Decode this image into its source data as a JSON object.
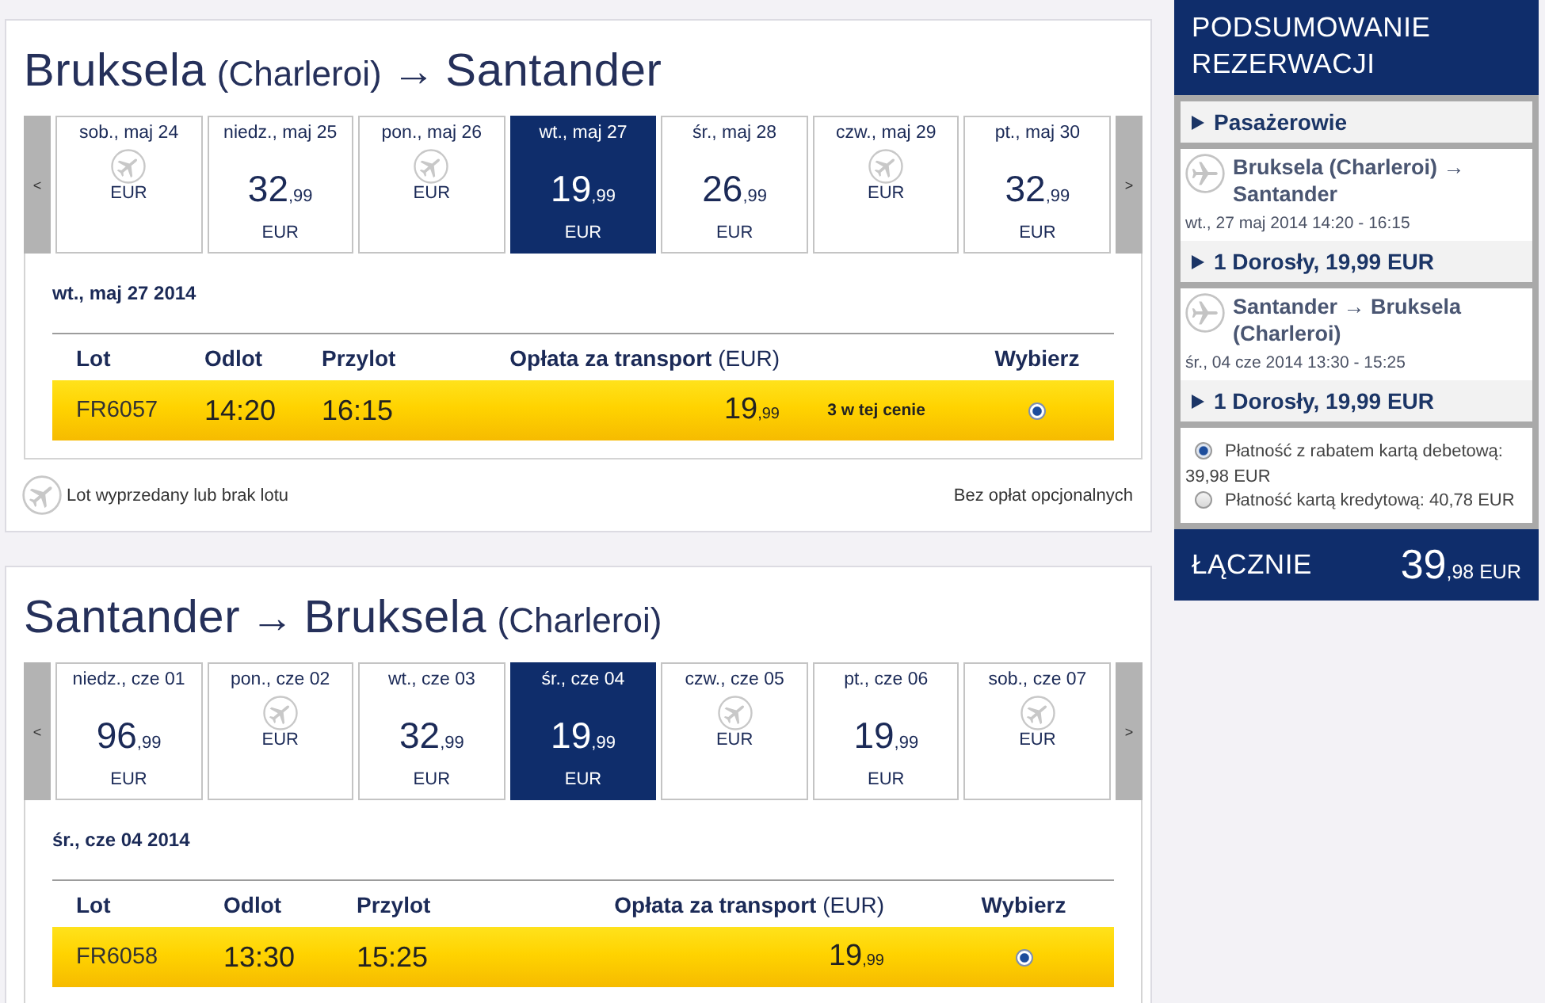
{
  "journeys": [
    {
      "title_parts": [
        {
          "kind": "city",
          "text": "Bruksela"
        },
        {
          "kind": "airport",
          "text": "(Charleroi)"
        },
        {
          "kind": "arrow",
          "text": "→"
        },
        {
          "kind": "city",
          "text": "Santander"
        }
      ],
      "prev": "<",
      "next": ">",
      "dates": [
        {
          "label": "sob., maj 24",
          "kind": "sold_out",
          "currency": "EUR",
          "selected": false
        },
        {
          "label": "niedz., maj 25",
          "kind": "fare",
          "price": "32",
          "cents": ",99",
          "currency": "EUR",
          "selected": false
        },
        {
          "label": "pon., maj 26",
          "kind": "sold_out",
          "currency": "EUR",
          "selected": false
        },
        {
          "label": "wt., maj 27",
          "kind": "fare",
          "price": "19",
          "cents": ",99",
          "currency": "EUR",
          "selected": true
        },
        {
          "label": "śr., maj 28",
          "kind": "fare",
          "price": "26",
          "cents": ",99",
          "currency": "EUR",
          "selected": false
        },
        {
          "label": "czw., maj 29",
          "kind": "sold_out",
          "currency": "EUR",
          "selected": false
        },
        {
          "label": "pt., maj 30",
          "kind": "fare",
          "price": "32",
          "cents": ",99",
          "currency": "EUR",
          "selected": false
        }
      ],
      "day_heading": "wt., maj 27 2014",
      "columns": [
        {
          "label": "Lot"
        },
        {
          "label": "Odlot"
        },
        {
          "label": "Przylot"
        },
        {
          "label": "Opłata za transport",
          "unit": "(EUR)"
        },
        {
          "label": "Wybierz"
        }
      ],
      "rows": [
        {
          "flight": "FR6057",
          "departure": "14:20",
          "arrival": "16:15",
          "price": "19",
          "cents": ",99",
          "note": "3 w tej cenie",
          "selected": true
        }
      ],
      "legend": {
        "text": "Lot wyprzedany lub brak lotu",
        "note": "Bez opłat opcjonalnych"
      }
    },
    {
      "title_parts": [
        {
          "kind": "city",
          "text": "Santander"
        },
        {
          "kind": "arrow",
          "text": "→"
        },
        {
          "kind": "city",
          "text": "Bruksela"
        },
        {
          "kind": "airport",
          "text": "(Charleroi)"
        }
      ],
      "prev": "<",
      "next": ">",
      "dates": [
        {
          "label": "niedz., cze 01",
          "kind": "fare",
          "price": "96",
          "cents": ",99",
          "currency": "EUR",
          "selected": false
        },
        {
          "label": "pon., cze 02",
          "kind": "sold_out",
          "currency": "EUR",
          "selected": false
        },
        {
          "label": "wt., cze 03",
          "kind": "fare",
          "price": "32",
          "cents": ",99",
          "currency": "EUR",
          "selected": false
        },
        {
          "label": "śr., cze 04",
          "kind": "fare",
          "price": "19",
          "cents": ",99",
          "currency": "EUR",
          "selected": true
        },
        {
          "label": "czw., cze 05",
          "kind": "sold_out",
          "currency": "EUR",
          "selected": false
        },
        {
          "label": "pt., cze 06",
          "kind": "fare",
          "price": "19",
          "cents": ",99",
          "currency": "EUR",
          "selected": false
        },
        {
          "label": "sob., cze 07",
          "kind": "sold_out",
          "currency": "EUR",
          "selected": false
        }
      ],
      "day_heading": "śr., cze 04 2014",
      "columns": [
        {
          "label": "Lot"
        },
        {
          "label": "Odlot"
        },
        {
          "label": "Przylot"
        },
        {
          "label": "Opłata za transport",
          "unit": "(EUR)"
        },
        {
          "label": "Wybierz"
        }
      ],
      "rows": [
        {
          "flight": "FR6058",
          "departure": "13:30",
          "arrival": "15:25",
          "price": "19",
          "cents": ",99",
          "selected": true
        }
      ]
    }
  ],
  "summary": {
    "title": "PODSUMOWANIE REZERWACJI",
    "blocks": [
      {
        "items": [
          {
            "kind": "toggle",
            "label": "Pasażerowie",
            "expanded": false
          }
        ]
      },
      {
        "items": [
          {
            "kind": "flight",
            "route": "Bruksela (Charleroi) → Santander",
            "time": "wt., 27 maj 2014 14:20 - 16:15"
          },
          {
            "kind": "toggle",
            "label": "1 Dorosły, 19,99 EUR",
            "expanded": false
          }
        ]
      },
      {
        "items": [
          {
            "kind": "flight",
            "route": "Santander → Bruksela (Charleroi)",
            "time": "śr., 04 cze 2014 13:30 - 15:25"
          },
          {
            "kind": "toggle",
            "label": "1 Dorosły, 19,99 EUR",
            "expanded": false
          }
        ]
      },
      {
        "items": [
          {
            "kind": "payment_option",
            "label": "Płatność z rabatem kartą debetową: 39,98 EUR",
            "selected": true
          },
          {
            "kind": "payment_option",
            "label": "Płatność kartą kredytową: 40,78 EUR",
            "selected": false
          }
        ]
      }
    ],
    "total": {
      "label": "ŁĄCZNIE",
      "amount": "39",
      "cents": ",98",
      "currency": "EUR"
    }
  }
}
